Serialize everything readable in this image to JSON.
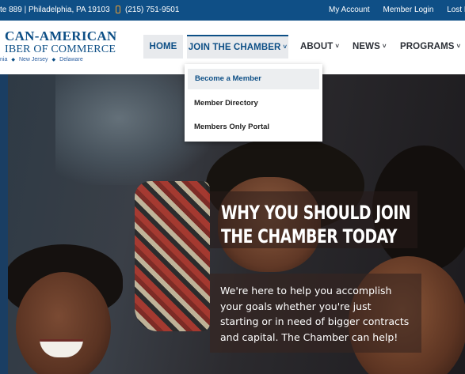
{
  "topbar": {
    "address": "te 889 | Philadelphia, PA 19103",
    "phone_icon": "phone-icon",
    "phone": "(215) 751-9501",
    "links": [
      "My Account",
      "Member Login",
      "Lost Pass"
    ]
  },
  "logo": {
    "line1": "CAN-AMERICAN",
    "line2": "IBER OF COMMERCE",
    "states": [
      "nia",
      "New Jersey",
      "Delaware"
    ]
  },
  "nav": {
    "items": [
      {
        "label": "HOME"
      },
      {
        "label": "JOIN THE CHAMBER"
      },
      {
        "label": "ABOUT"
      },
      {
        "label": "NEWS"
      },
      {
        "label": "PROGRAMS"
      }
    ],
    "chevron": "˅"
  },
  "dropdown": {
    "items": [
      "Become a Member",
      "Member Directory",
      "Members Only Portal"
    ]
  },
  "hero": {
    "title_line1": "WHY YOU SHOULD JOIN",
    "title_line2": "THE CHAMBER TODAY",
    "body_lines": [
      "We're here to help you accomplish",
      "your goals whether you're just",
      "starting or in need of bigger contracts",
      "and capital. The Chamber can help!"
    ]
  },
  "colors": {
    "brand_blue": "#0d4f86",
    "topbar": "#0f4f86",
    "phone_accent": "#f0a030"
  }
}
